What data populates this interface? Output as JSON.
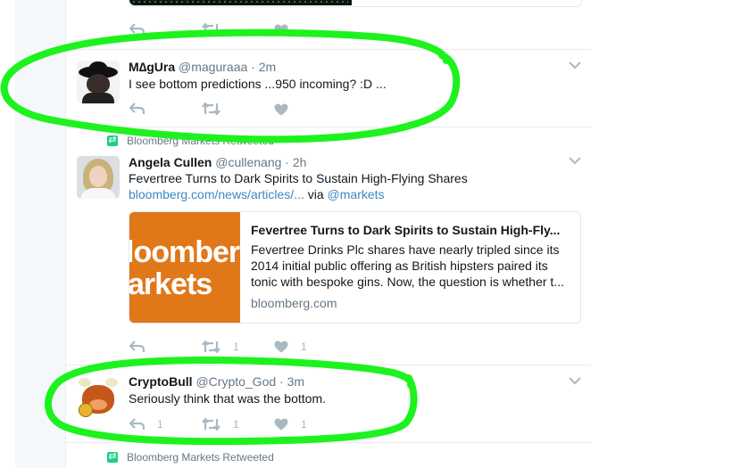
{
  "colors": {
    "accent": "#3b88c3",
    "highlight_stroke": "#1ef21e",
    "retweet_green": "#19cf86",
    "muted": "#657786",
    "icon": "#aab8c2"
  },
  "top_actions": {
    "reply_icon": "reply-icon",
    "retweet_icon": "retweet-icon",
    "like_icon": "heart-icon"
  },
  "tweets": [
    {
      "name": "M∆gUra",
      "handle": "@maguraaa",
      "time": "· 2m",
      "text": "I see bottom predictions ...950 incoming? :D ...",
      "retweets": "",
      "likes": ""
    },
    {
      "retweeted_by": "Bloomberg Markets Retweeted",
      "name": "Angela Cullen",
      "handle": "@cullenang",
      "time": "· 2h",
      "text": "Fevertree Turns to Dark Spirits to Sustain High-Flying Shares",
      "link": "bloomberg.com/news/articles/...",
      "via": "via",
      "via_handle": "@markets",
      "card": {
        "image_text_1": "loomberg",
        "image_text_2": "arkets",
        "title": "Fevertree Turns to Dark Spirits to Sustain High-Fly...",
        "description": "Fevertree Drinks Plc shares have nearly tripled since its 2014 initial public offering as British hipsters paired its tonic with bespoke gins. Now, the question is whether t...",
        "domain": "bloomberg.com"
      },
      "retweets": "1",
      "likes": "1"
    },
    {
      "name": "CryptoBull",
      "handle": "@Crypto_God",
      "time": "· 3m",
      "text": "Seriously think that was the bottom.",
      "replies": "1",
      "retweets": "1",
      "likes": "1"
    }
  ],
  "next_retweeted_by": "Bloomberg Markets Retweeted"
}
